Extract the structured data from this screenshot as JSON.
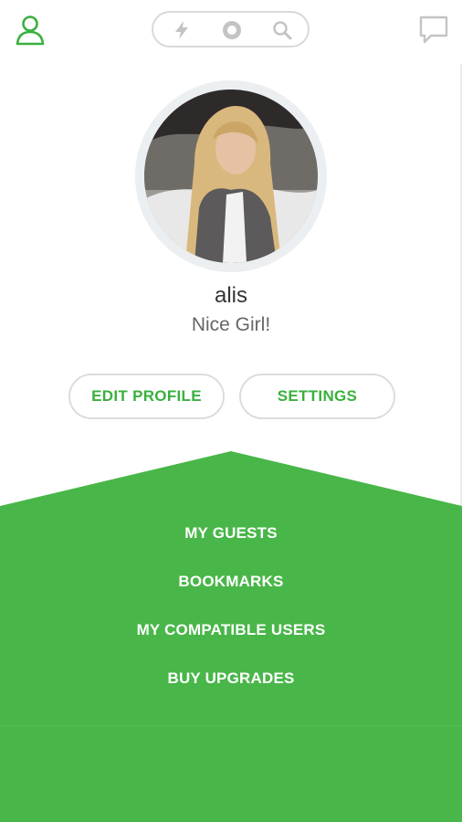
{
  "profile": {
    "username": "alis",
    "status": "Nice Girl!"
  },
  "actions": {
    "edit_profile": "EDIT PROFILE",
    "settings": "SETTINGS"
  },
  "menu": {
    "items": [
      {
        "label": "MY GUESTS"
      },
      {
        "label": "BOOKMARKS"
      },
      {
        "label": "MY COMPATIBLE USERS"
      },
      {
        "label": "BUY UPGRADES"
      }
    ]
  },
  "icons": {
    "top_left": "user-icon",
    "nav": [
      "bolt-icon",
      "record-icon",
      "search-icon"
    ],
    "top_right": "chat-icon"
  },
  "colors": {
    "accent": "#3ab03e",
    "green_panel": "#49b649",
    "nav_icon": "#c4c4c4"
  }
}
